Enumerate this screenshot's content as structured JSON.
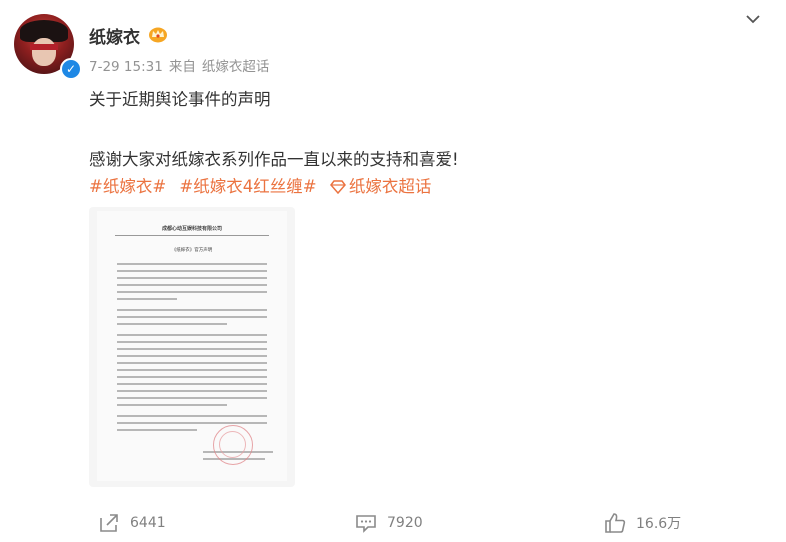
{
  "user": {
    "name": "纸嫁衣",
    "verified": true
  },
  "meta": {
    "time": "7-29 15:31",
    "source_prefix": "来自",
    "source": "纸嫁衣超话"
  },
  "post": {
    "line1": "关于近期舆论事件的声明",
    "line2": "感谢大家对纸嫁衣系列作品一直以来的支持和喜爱!",
    "tags": [
      "#纸嫁衣#",
      "#纸嫁衣4红丝缠#"
    ],
    "supertopic": "纸嫁衣超话"
  },
  "document": {
    "company": "成都心动互娱科技有限公司",
    "title": "《纸嫁衣》官方声明"
  },
  "actions": {
    "share_count": "6441",
    "comment_count": "7920",
    "like_count": "16.6万"
  },
  "colors": {
    "tag": "#eb7340",
    "meta": "#939393",
    "text": "#333333",
    "verified": "#1e88e5"
  },
  "icons": {
    "menu": "chevron-down-icon",
    "verified": "verified-icon",
    "badge": "vip-crown-icon",
    "supertopic": "diamond-icon",
    "share": "share-icon",
    "comment": "comment-icon",
    "like": "like-icon"
  }
}
